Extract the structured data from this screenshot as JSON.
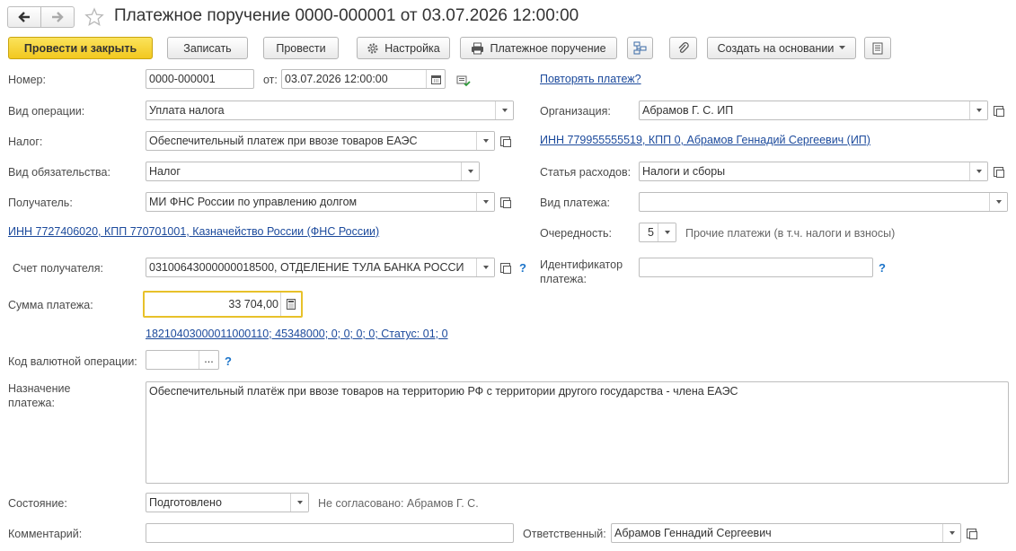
{
  "window": {
    "title": "Платежное поручение 0000-000001 от 03.07.2026 12:00:00"
  },
  "toolbar": {
    "post_close": "Провести и закрыть",
    "save": "Записать",
    "post": "Провести",
    "settings": "Настройка",
    "print_order": "Платежное поручение",
    "create_based": "Создать на основании"
  },
  "form": {
    "number_label": "Номер:",
    "number_value": "0000-000001",
    "date_label": "от:",
    "date_value": "03.07.2026 12:00:00",
    "repeat_link": "Повторять платеж?",
    "operation_label": "Вид операции:",
    "operation_value": "Уплата налога",
    "org_label": "Организация:",
    "org_value": "Абрамов Г. С. ИП",
    "tax_label": "Налог:",
    "tax_value": "Обеспечительный платеж при ввозе товаров ЕАЭС",
    "org_inn_link": "ИНН 779955555519, КПП 0, Абрамов Геннадий Сергеевич (ИП)",
    "obligation_label": "Вид обязательства:",
    "obligation_value": "Налог",
    "expense_label": "Статья расходов:",
    "expense_value": "Налоги и сборы",
    "recipient_label": "Получатель:",
    "recipient_value": "МИ ФНС России по управлению долгом",
    "payment_type_label": "Вид платежа:",
    "payment_type_value": "",
    "recipient_inn_link": "ИНН 7727406020, КПП 770701001, Казначейство России (ФНС России)",
    "priority_label": "Очередность:",
    "priority_value": "5",
    "priority_desc": "Прочие платежи (в т.ч. налоги и взносы)",
    "account_label": "Счет получателя:",
    "account_value": "03100643000000018500, ОТДЕЛЕНИЕ ТУЛА БАНКА РОССИ",
    "identifier_label_1": "Идентификатор",
    "identifier_label_2": "платежа:",
    "identifier_value": "",
    "help_mark": "?",
    "amount_label": "Сумма платежа:",
    "amount_value": "33 704,00",
    "kbk_link": "18210403000011000110; 45348000; 0; 0; 0; 0; Статус: 01; 0",
    "currency_code_label": "Код валютной операции:",
    "currency_code_value": "",
    "ellipsis": "...",
    "purpose_label_1": "Назначение",
    "purpose_label_2": "платежа:",
    "purpose_value": "Обеспечительный платёж при ввозе товаров на территорию РФ с территории другого государства - члена ЕАЭС",
    "state_label": "Состояние:",
    "state_value": "Подготовлено",
    "approval_text": "Не согласовано: Абрамов Г. С.",
    "comment_label": "Комментарий:",
    "comment_value": "",
    "responsible_label": "Ответственный:",
    "responsible_value": "Абрамов Геннадий Сергеевич"
  },
  "colors": {
    "primary_button": "#f2c81f",
    "link": "#1c4a9c",
    "focus_border": "#e8c12a",
    "help": "#1a73c9"
  },
  "icons": [
    "back-arrow-icon",
    "forward-arrow-icon",
    "star-icon",
    "gear-icon",
    "printer-icon",
    "structure-icon",
    "paperclip-icon",
    "list-icon",
    "calendar-icon",
    "calculator-icon",
    "document-green-icon"
  ]
}
